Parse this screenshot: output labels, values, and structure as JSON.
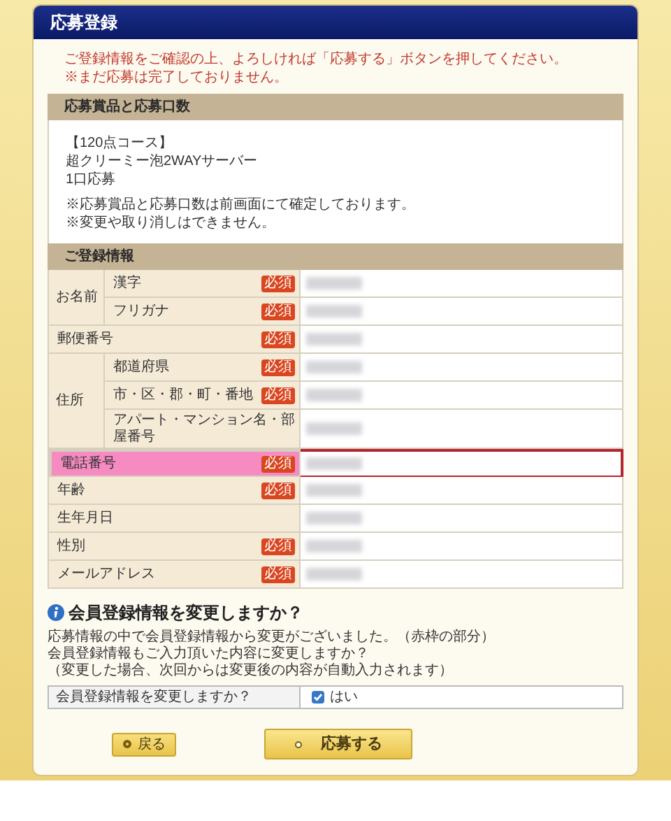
{
  "title": "応募登録",
  "notice": [
    "ご登録情報をご確認の上、よろしければ「応募する」ボタンを押してください。",
    "※まだ応募は完了しておりません。"
  ],
  "prize_section": {
    "heading": "応募賞品と応募口数",
    "lines": [
      "【120点コース】",
      "超クリーミー泡2WAYサーバー",
      "1口応募"
    ],
    "notes": [
      "※応募賞品と応募口数は前画面にて確定しております。",
      "※変更や取り消しはできません。"
    ]
  },
  "registration": {
    "heading": "ご登録情報",
    "rows": [
      {
        "kind": "group",
        "label": "お名前",
        "children": [
          {
            "label": "漢字",
            "badge": "必須",
            "highlighted": false
          },
          {
            "label": "フリガナ",
            "badge": "必須",
            "highlighted": false
          }
        ]
      },
      {
        "kind": "single",
        "label": "郵便番号",
        "badge": "必須",
        "highlighted": false
      },
      {
        "kind": "group",
        "label": "住所",
        "children": [
          {
            "label": "都道府県",
            "badge": "必須",
            "highlighted": false
          },
          {
            "label": "市・区・郡・町・番地",
            "badge": "必須",
            "highlighted": false
          },
          {
            "label": "アパート・マンション名・部屋番号",
            "highlighted": false
          }
        ]
      },
      {
        "kind": "single",
        "label": "電話番号",
        "badge": "必須",
        "highlighted": true
      },
      {
        "kind": "single",
        "label": "年齢",
        "badge": "必須",
        "highlighted": false
      },
      {
        "kind": "single",
        "label": "生年月日",
        "highlighted": false
      },
      {
        "kind": "single",
        "label": "性別",
        "badge": "必須",
        "highlighted": false
      },
      {
        "kind": "single",
        "label": "メールアドレス",
        "badge": "必須",
        "highlighted": false
      }
    ]
  },
  "update_section": {
    "heading": "会員登録情報を変更しますか？",
    "description": [
      "応募情報の中で会員登録情報から変更がございました。（赤枠の部分）",
      "会員登録情報もご入力頂いた内容に変更しますか？",
      "（変更した場合、次回からは変更後の内容が自動入力されます）"
    ],
    "question": "会員登録情報を変更しますか？",
    "option": {
      "label": "はい",
      "checked": true
    }
  },
  "buttons": {
    "back": "戻る",
    "submit": "応募する"
  }
}
